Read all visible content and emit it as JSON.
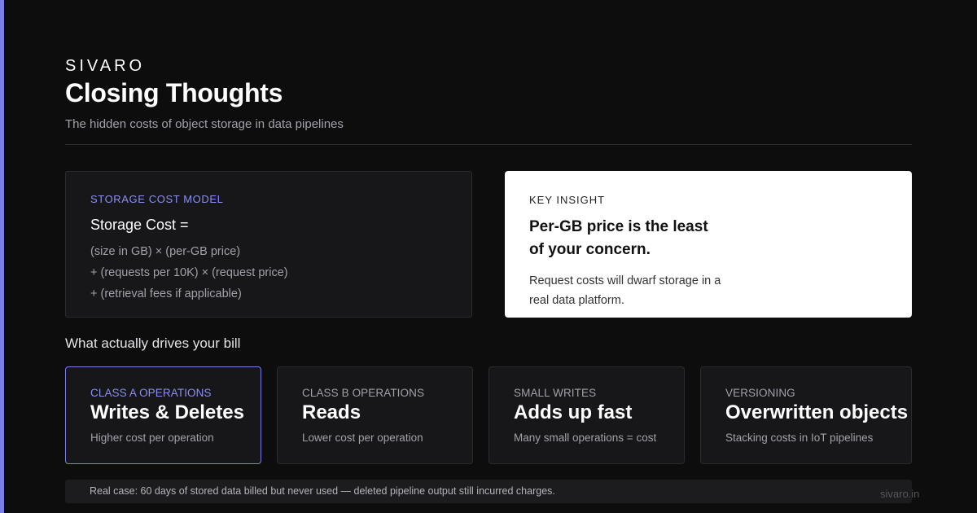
{
  "brand": "SIVARO",
  "header": {
    "title": "Closing Thoughts",
    "subtitle": "The hidden costs of object storage in data pipelines"
  },
  "model": {
    "label": "STORAGE COST MODEL",
    "heading": "Storage Cost =",
    "lines": [
      "(size in GB) × (per-GB price)",
      "+ (requests per 10K) × (request price)",
      "+ (retrieval fees if applicable)"
    ]
  },
  "insight": {
    "label": "KEY INSIGHT",
    "heading": "Per-GB price is the least of your concern.",
    "body": "Request costs will dwarf storage in a real data platform."
  },
  "drivers": {
    "heading": "What actually drives your bill",
    "items": [
      {
        "label": "CLASS A OPERATIONS",
        "title": "Writes & Deletes",
        "desc": "Higher cost per operation"
      },
      {
        "label": "CLASS B OPERATIONS",
        "title": "Reads",
        "desc": "Lower cost per operation"
      },
      {
        "label": "SMALL WRITES",
        "title": "Adds up fast",
        "desc": "Many small operations = cost"
      },
      {
        "label": "VERSIONING",
        "title": "Overwritten objects",
        "desc": "Stacking costs in IoT pipelines"
      }
    ]
  },
  "footer": {
    "note": "Real case: 60 days of stored data billed but never used — deleted pipeline output still incurred charges.",
    "site": "sivaro.in"
  },
  "colors": {
    "background": "#0d0d0e",
    "accent": "#7b80e8",
    "card": "#17171a",
    "insight_card": "#ffffff"
  }
}
